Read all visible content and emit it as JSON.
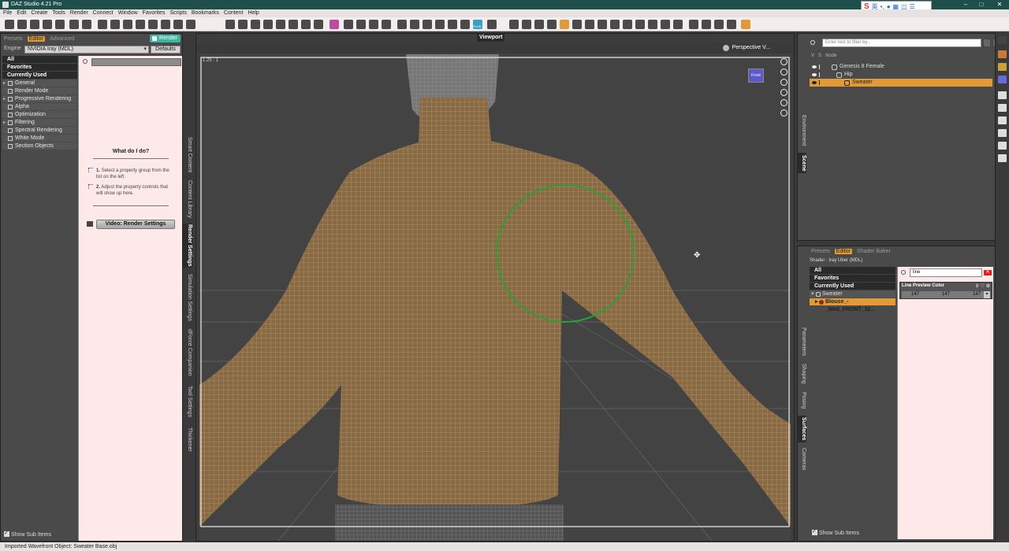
{
  "window": {
    "title": "DAZ Studio 4.21 Pro"
  },
  "ime": {
    "label": "英"
  },
  "menu": [
    "File",
    "Edit",
    "Create",
    "Tools",
    "Render",
    "Connect",
    "Window",
    "Favorites",
    "Scripts",
    "Bookmarks",
    "Content",
    "Help"
  ],
  "toolbar": {
    "plus_badge": "PLUS"
  },
  "left_panel": {
    "tabs": [
      "Presets",
      "Editor",
      "Advanced"
    ],
    "render_button": "Render",
    "engine_label": "Engine",
    "engine_value": "NVIDIA Iray (MDL)",
    "defaults_button": "Defaults",
    "top_groups": [
      "All",
      "Favorites",
      "Currently Used"
    ],
    "groups": [
      {
        "label": "General",
        "expandable": true
      },
      {
        "label": "Render Mode",
        "expandable": false
      },
      {
        "label": "Progressive Rendering",
        "expandable": true
      },
      {
        "label": "Alpha",
        "expandable": false
      },
      {
        "label": "Optimization",
        "expandable": false
      },
      {
        "label": "Filtering",
        "expandable": true
      },
      {
        "label": "Spectral Rendering",
        "expandable": false
      },
      {
        "label": "White Mode",
        "expandable": false
      },
      {
        "label": "Section Objects",
        "expandable": false
      }
    ],
    "help_title": "What do I do?",
    "help_step1_num": "1.",
    "help_step1": "Select a property group from the list on the left.",
    "help_step2_num": "2.",
    "help_step2": "Adjust the property controls that will show up here.",
    "video_button": "Video: Render Settings",
    "show_sub_items": "Show Sub Items"
  },
  "left_vtabs": [
    "Smart Content",
    "Content Library",
    "Render Settings",
    "Simulation Settings",
    "dForce Companion",
    "Tool Settings",
    "Thickener"
  ],
  "viewport": {
    "title": "Viewport",
    "camera": "Perspective V...",
    "resolution": "1.25 : 1",
    "nav_cube_label": "Front"
  },
  "scene_panel": {
    "search_placeholder": "Enter text to filter by...",
    "columns": [
      "V",
      "S",
      "Node"
    ],
    "nodes": [
      {
        "label": "Genesis 8 Female",
        "depth": 0,
        "selected": false
      },
      {
        "label": "Hip",
        "depth": 1,
        "selected": false
      },
      {
        "label": "Sweater",
        "depth": 2,
        "selected": true
      }
    ]
  },
  "right_vtabs_top": [
    "Environment",
    "Scene"
  ],
  "param_panel": {
    "tabs": [
      "Presets",
      "Editor",
      "Shader Baker"
    ],
    "shader_label": "Shader : Iray Uber (MDL)",
    "top_groups": [
      "All",
      "Favorites",
      "Currently Used"
    ],
    "tree": [
      {
        "label": "Sweater",
        "selected": false
      },
      {
        "label": "Blouse_-_Med_FRONT_32...",
        "selected": true
      }
    ],
    "search_value": "line",
    "property_name": "Line Preview Color",
    "color_values": [
      "147",
      "147",
      "147"
    ],
    "show_sub_items": "Show Sub Items"
  },
  "right_vtabs_bottom": [
    "Parameters",
    "Shaping",
    "Posing",
    "Surfaces",
    "Cameras"
  ],
  "status": {
    "message": "Imported Wavefront Object: Sweater Base.obj"
  },
  "colors": {
    "accent": "#e09a36",
    "render": "#3fb5a0",
    "panel_bg": "#fde9e9",
    "titlebar": "#1f4f4a"
  }
}
